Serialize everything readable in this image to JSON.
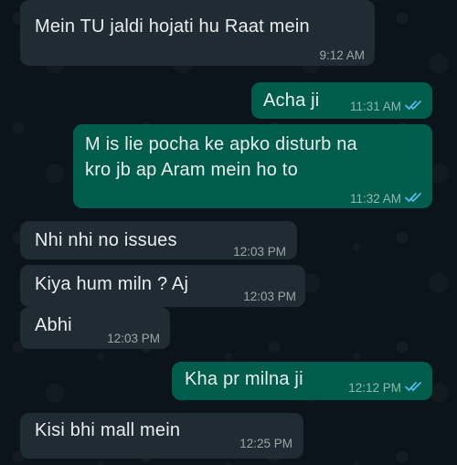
{
  "messages": [
    {
      "text": "Mein TU jaldi hojati hu Raat mein",
      "time": "9:12 AM"
    },
    {
      "text": "Acha ji",
      "time": "11:31 AM",
      "ticks": "read-double-check-icon"
    },
    {
      "text_lines": [
        "M is lie pocha ke apko disturb na",
        "kro jb ap Aram mein ho to"
      ],
      "time": "11:32 AM",
      "ticks": "read-double-check-icon"
    },
    {
      "text": "Nhi nhi no issues",
      "time": "12:03 PM"
    },
    {
      "text": "Kiya hum miln ? Aj",
      "time": "12:03 PM"
    },
    {
      "text": "Abhi",
      "time": "12:03 PM"
    },
    {
      "text": "Kha pr milna ji",
      "time": "12:12 PM",
      "ticks": "read-double-check-icon"
    },
    {
      "text": "Kisi bhi mall mein",
      "time": "12:25 PM"
    }
  ],
  "colors": {
    "background": "#0b141a",
    "incoming_bubble": "#202c33",
    "outgoing_bubble": "#005c4b",
    "read_tick": "#53bdeb"
  }
}
